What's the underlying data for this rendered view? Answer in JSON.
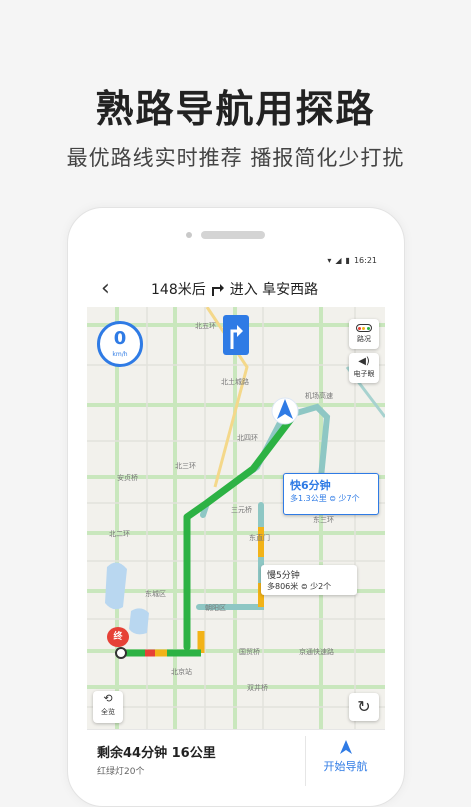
{
  "promo": {
    "headline": "熟路导航用探路",
    "subline": "最优路线实时推荐  播报简化少打扰"
  },
  "status_bar": {
    "time": "16:21"
  },
  "nav": {
    "distance": "148米后",
    "instruction": "进入 阜安西路"
  },
  "speed": {
    "value": "0",
    "unit": "km/h"
  },
  "side_controls": {
    "traffic": "路况",
    "camera": "电子眼",
    "overview": "全览"
  },
  "routes": {
    "fast": {
      "title": "快6分钟",
      "distance": "多1.3公里",
      "lights": "少7个"
    },
    "slow": {
      "title": "慢5分钟",
      "distance": "多806米",
      "lights": "少2个"
    }
  },
  "destination_label": "终",
  "map_labels": [
    "北五环",
    "北四环",
    "北土城路",
    "安贞桥",
    "北三环",
    "三元桥",
    "北二环",
    "东城区",
    "朝阳区",
    "东直门",
    "东三环",
    "国贸桥",
    "京通快速路",
    "北京站",
    "双井桥",
    "机场高速"
  ],
  "summary": {
    "remain": "剩余44分钟  16公里",
    "lights": "红绿灯20个"
  },
  "start_button": {
    "label": "开始导航"
  },
  "colors": {
    "accent": "#2f7be5",
    "route_green": "#2db244",
    "route_yellow": "#f2b318",
    "route_red": "#e64137",
    "alt_route": "#8ec7c4"
  }
}
